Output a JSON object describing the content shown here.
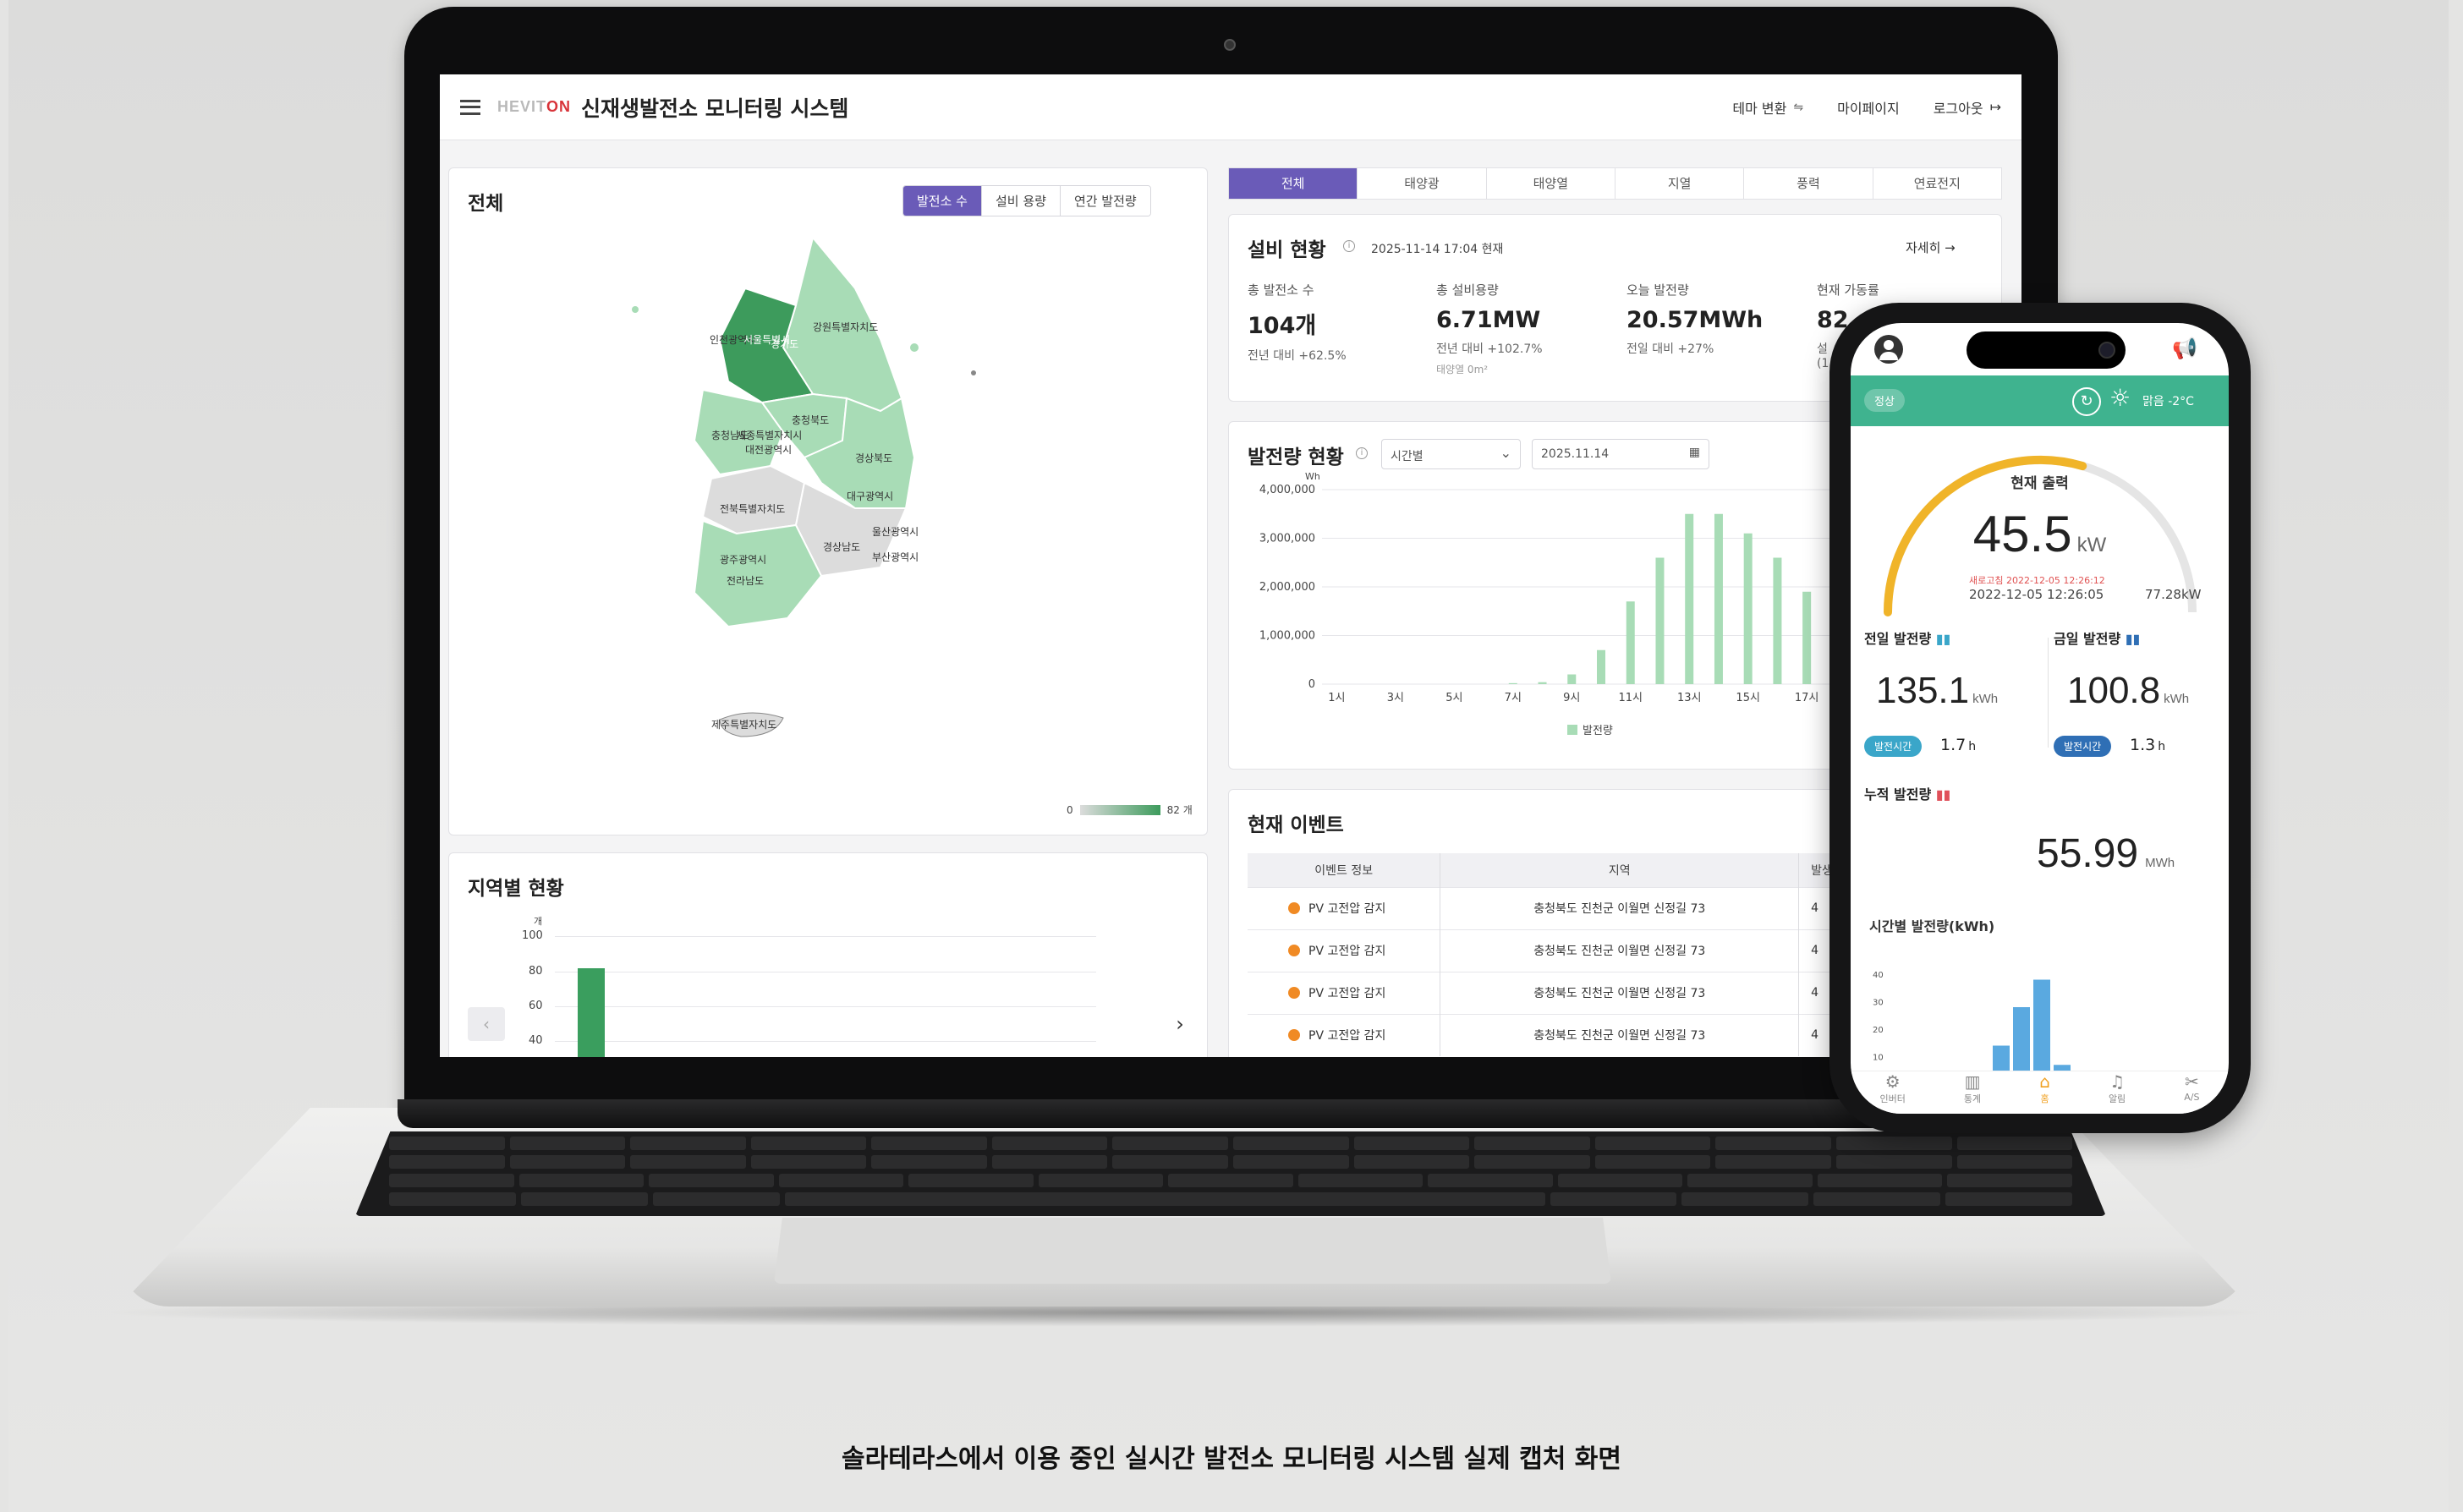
{
  "app": {
    "logo_prefix": "HEVIT",
    "logo_suffix": "ON",
    "title": "신재생발전소 모니터링 시스템",
    "actions": [
      {
        "label": "테마 변환",
        "icon": "theme-icon"
      },
      {
        "label": "마이페이지"
      },
      {
        "label": "로그아웃",
        "icon": "logout-icon"
      }
    ]
  },
  "map_panel": {
    "title": "전체",
    "segments": [
      "발전소 수",
      "설비 용량",
      "연간 발전량"
    ],
    "active_segment": "발전소 수",
    "region_labels": [
      "강원특별자치도",
      "인천광역시",
      "서울특별시",
      "경기도",
      "충청북도",
      "세종특별자치시",
      "충청남도",
      "대전광역시",
      "경상북도",
      "대구광역시",
      "전북특별자치도",
      "울산광역시",
      "경상남도",
      "부산광역시",
      "광주광역시",
      "전라남도",
      "제주특별자치도"
    ],
    "legend_min": "0",
    "legend_max": "82 개",
    "colors": {
      "low": "#dcdcdc",
      "mid": "#a8dcb6",
      "high": "#3d9b5c"
    }
  },
  "region_panel": {
    "title": "지역별 현황",
    "unit": "개",
    "y_ticks": [
      "100",
      "80",
      "60",
      "40"
    ],
    "prev_icon": "chevron-left-icon",
    "next_icon": "chevron-right-icon",
    "chart_data": {
      "type": "bar",
      "values": [
        82
      ],
      "ylim": [
        0,
        100
      ],
      "ylabel": "개"
    }
  },
  "source_tabs": [
    "전체",
    "태양광",
    "태양열",
    "지열",
    "풍력",
    "연료전지"
  ],
  "active_source_tab": "전체",
  "facility": {
    "title": "설비 현황",
    "timestamp": "2025-11-14 17:04 현재",
    "detail_link": "자세히 →",
    "stats": [
      {
        "label": "총 발전소 수",
        "value": "104개",
        "sub": "전년 대비 +62.5%",
        "sub2": ""
      },
      {
        "label": "총 설비용량",
        "value": "6.71MW",
        "sub": "전년 대비 +102.7%",
        "sub2": "태양열 0m²"
      },
      {
        "label": "오늘 발전량",
        "value": "20.57MWh",
        "sub": "전일 대비 +27%",
        "sub2": ""
      },
      {
        "label": "현재 가동률",
        "value": "82.",
        "sub": "설",
        "sub2": "(1"
      }
    ]
  },
  "generation": {
    "title": "발전량 현황",
    "select_value": "시간별",
    "date_value": "2025.11.14",
    "chart_data": {
      "type": "bar",
      "ylabel": "Wh",
      "y_ticks": [
        "4,000,000",
        "3,000,000",
        "2,000,000",
        "1,000,000",
        "0"
      ],
      "ylim": [
        0,
        4000000
      ],
      "x_tick_labels": [
        "1시",
        "3시",
        "5시",
        "7시",
        "9시",
        "11시",
        "13시",
        "15시",
        "17시",
        "19시"
      ],
      "categories": [
        "1시",
        "2시",
        "3시",
        "4시",
        "5시",
        "6시",
        "7시",
        "8시",
        "9시",
        "10시",
        "11시",
        "12시",
        "13시",
        "14시",
        "15시",
        "16시",
        "17시",
        "18시",
        "19시"
      ],
      "series": [
        {
          "name": "발전량",
          "values": [
            0,
            0,
            0,
            0,
            0,
            0,
            20000,
            40000,
            200000,
            700000,
            1700000,
            2600000,
            3500000,
            3500000,
            3100000,
            2600000,
            1900000,
            900000,
            0
          ]
        }
      ],
      "color": "#a8dcb6"
    }
  },
  "events": {
    "title": "현재 이벤트",
    "columns": [
      "이벤트 정보",
      "지역",
      "발생"
    ],
    "rows": [
      {
        "info": "PV 고전압 감지",
        "region": "충청북도 진천군 이월면 신정길 73",
        "extra": "4"
      },
      {
        "info": "PV 고전압 감지",
        "region": "충청북도 진천군 이월면 신정길 73",
        "extra": "4"
      },
      {
        "info": "PV 고전압 감지",
        "region": "충청북도 진천군 이월면 신정길 73",
        "extra": "4"
      },
      {
        "info": "PV 고전압 감지",
        "region": "충청북도 진천군 이월면 신정길 73",
        "extra": "4"
      }
    ]
  },
  "phone": {
    "status": "정상",
    "weather": "맑음 -2°C",
    "gauge_title": "현재 출력",
    "gauge_value": "45.5",
    "gauge_unit": "kW",
    "refresh_note": "새로고침 2022-12-05 12:26:12",
    "gauge_time": "2022-12-05 12:26:05",
    "gauge_max": "77.28kW",
    "gauge_fraction": 0.59,
    "yesterday": {
      "label": "전일 발전량",
      "value": "135.1",
      "unit": "kWh",
      "badge": "발전시간",
      "hours": "1.7",
      "hours_unit": "h"
    },
    "today": {
      "label": "금일 발전량",
      "value": "100.8",
      "unit": "kWh",
      "badge": "발전시간",
      "hours": "1.3",
      "hours_unit": "h"
    },
    "cumulative": {
      "label": "누적 발전량",
      "value": "55.99",
      "unit": "MWh"
    },
    "hourly_title": "시간별 발전량(kWh)",
    "hourly_ticks": [
      "40",
      "30",
      "20",
      "10"
    ],
    "hourly_chart": {
      "type": "bar",
      "values": [
        3,
        14,
        28,
        38,
        7
      ],
      "ylim": [
        0,
        40
      ]
    },
    "nav": [
      "인버터",
      "통계",
      "홈",
      "알림",
      "A/S"
    ],
    "nav_icons": [
      "inverter-icon",
      "stats-icon",
      "home-icon",
      "bell-icon",
      "tools-icon"
    ],
    "active_nav": "홈"
  },
  "caption": "솔라테라스에서 이용 중인 실시간 발전소 모니터링 시스템 실제 캡처 화면"
}
